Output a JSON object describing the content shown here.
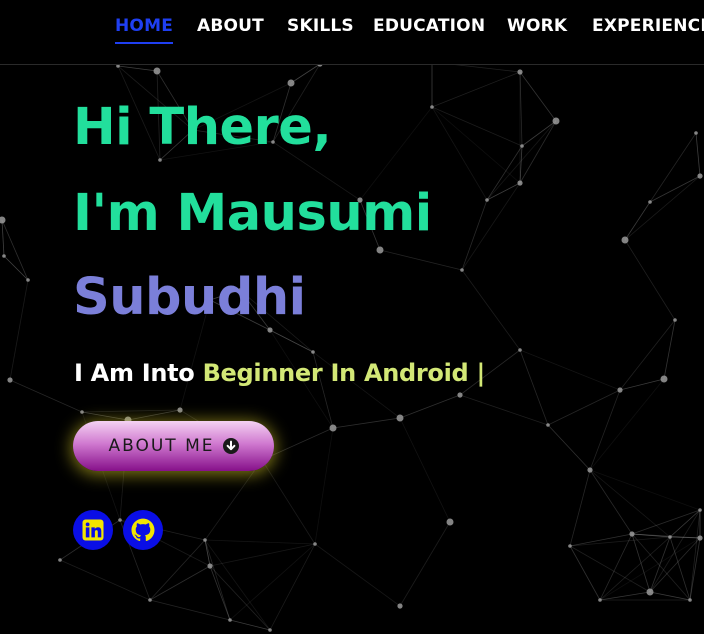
{
  "nav": {
    "items": [
      {
        "label": "HOME",
        "active": true
      },
      {
        "label": "ABOUT",
        "active": false
      },
      {
        "label": "SKILLS",
        "active": false
      },
      {
        "label": "EDUCATION",
        "active": false
      },
      {
        "label": "WORK",
        "active": false
      },
      {
        "label": "EXPERIENCE",
        "active": false
      }
    ]
  },
  "hero": {
    "greeting": "Hi There,",
    "intro": "I'm Mausumi",
    "surname": "Subudhi",
    "typed_prefix": "I Am Into",
    "typed_role": "Beginner In Android |"
  },
  "cta": {
    "label": "ABOUT ME",
    "icon": "chevron-down-circle-icon"
  },
  "social": [
    {
      "name": "linkedin",
      "icon": "linkedin-icon"
    },
    {
      "name": "github",
      "icon": "github-icon"
    }
  ],
  "colors": {
    "background": "#000000",
    "nav_active": "#1f3ff2",
    "name_green": "#22df9c",
    "name_violet": "#7b7fd9",
    "role_yellow": "#d3e876",
    "social_bg": "#0a0ee6",
    "social_fg": "#f2e600"
  }
}
